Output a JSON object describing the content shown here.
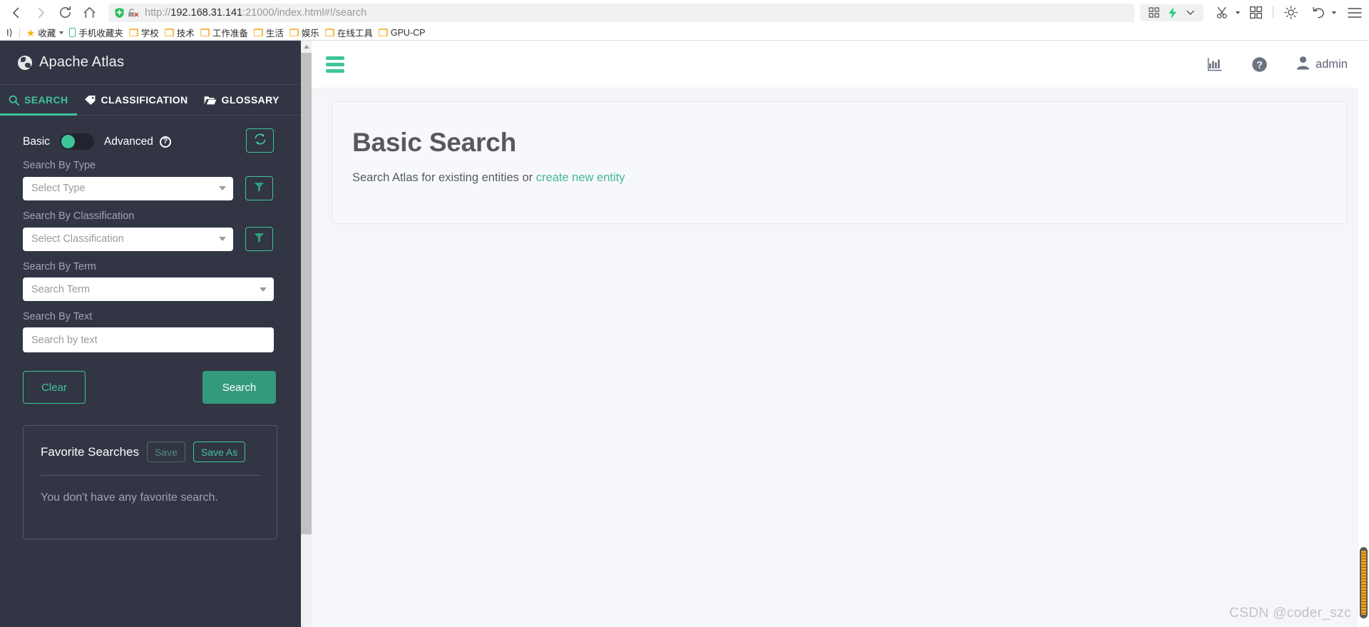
{
  "browser": {
    "nav": {
      "back_icon": "back-arrow-icon",
      "forward_icon": "forward-arrow-icon",
      "reload_icon": "reload-icon",
      "home_icon": "home-icon"
    },
    "url": {
      "scheme": "http://",
      "domain": "192.168.31.141",
      "rest": ":21000/index.html#!/search",
      "full": "http://192.168.31.141:21000/index.html#!/search",
      "shield_icon": "shield-icon",
      "lock_broken_icon": "broken-lock-icon"
    },
    "toolbar_right": [
      {
        "name": "qr-grid-icon",
        "glyph": "grid"
      },
      {
        "name": "lightning-bolt-icon",
        "glyph": "bolt"
      },
      {
        "name": "chevron-down-icon",
        "glyph": "chevron"
      },
      {
        "name": "scissors-icon",
        "glyph": "scissors"
      },
      {
        "name": "apps-grid-icon",
        "glyph": "apps"
      },
      {
        "name": "brightness-icon",
        "glyph": "sun"
      },
      {
        "name": "undo-icon",
        "glyph": "undo"
      },
      {
        "name": "menu-icon",
        "glyph": "menu"
      }
    ],
    "bookmarks": {
      "overflow_label": "I⟩",
      "items": [
        {
          "label": "收藏",
          "icon": "star-icon",
          "has_caret": true
        },
        {
          "label": "手机收藏夹",
          "icon": "phone-icon",
          "has_caret": false
        },
        {
          "label": "学校",
          "icon": "folder-icon",
          "has_caret": false
        },
        {
          "label": "技术",
          "icon": "folder-icon",
          "has_caret": false
        },
        {
          "label": "工作准备",
          "icon": "folder-icon",
          "has_caret": false
        },
        {
          "label": "生活",
          "icon": "folder-icon",
          "has_caret": false
        },
        {
          "label": "娱乐",
          "icon": "folder-icon",
          "has_caret": false
        },
        {
          "label": "在线工具",
          "icon": "folder-icon",
          "has_caret": false
        },
        {
          "label": "GPU-CP",
          "icon": "folder-icon",
          "has_caret": false
        }
      ]
    }
  },
  "sidebar": {
    "brand": {
      "title": "Apache Atlas",
      "logo_icon": "atlas-globe-icon"
    },
    "tabs": [
      {
        "label": "SEARCH",
        "icon": "search-icon",
        "active": true
      },
      {
        "label": "CLASSIFICATION",
        "icon": "tag-icon",
        "active": false
      },
      {
        "label": "GLOSSARY",
        "icon": "folder-open-icon",
        "active": false
      }
    ],
    "mode_toggle": {
      "basic_label": "Basic",
      "advanced_label": "Advanced",
      "state": "Basic",
      "help_icon": "question-mark-icon",
      "help_glyph": "?"
    },
    "refresh_button": {
      "icon": "refresh-icon",
      "title": "Refresh"
    },
    "fields": [
      {
        "label": "Search By Type",
        "placeholder": "Select Type",
        "value": "",
        "control": "select",
        "has_filter_button": true,
        "filter_icon": "filter-icon"
      },
      {
        "label": "Search By Classification",
        "placeholder": "Select Classification",
        "value": "",
        "control": "select",
        "has_filter_button": true,
        "filter_icon": "filter-icon"
      },
      {
        "label": "Search By Term",
        "placeholder": "Search Term",
        "value": "",
        "control": "select",
        "has_filter_button": false
      },
      {
        "label": "Search By Text",
        "placeholder": "Search by text",
        "value": "",
        "control": "text",
        "has_filter_button": false
      }
    ],
    "actions": {
      "clear_label": "Clear",
      "search_label": "Search"
    },
    "favorites": {
      "title": "Favorite Searches",
      "save_label": "Save",
      "save_as_label": "Save As",
      "empty_text": "You don't have any favorite search."
    }
  },
  "main": {
    "header": {
      "hamburger_icon": "hamburger-menu-icon",
      "stats_icon": "bar-chart-statistics-icon",
      "help_icon": "help-circle-icon",
      "user_icon": "user-avatar-icon",
      "user_name": "admin"
    },
    "panel": {
      "title": "Basic Search",
      "subtitle_prefix": "Search Atlas for existing entities or ",
      "link_label": "create new entity"
    }
  },
  "watermark": {
    "text": "CSDN @coder_szc"
  },
  "colors": {
    "accent_green": "#3ec49a",
    "button_green": "#349a7c",
    "sidebar_bg": "#323544",
    "content_bg": "#f5f6fa",
    "panel_bg": "#f7f8fb",
    "link_green": "#46b69c",
    "muted_text": "#a0a3b1"
  }
}
